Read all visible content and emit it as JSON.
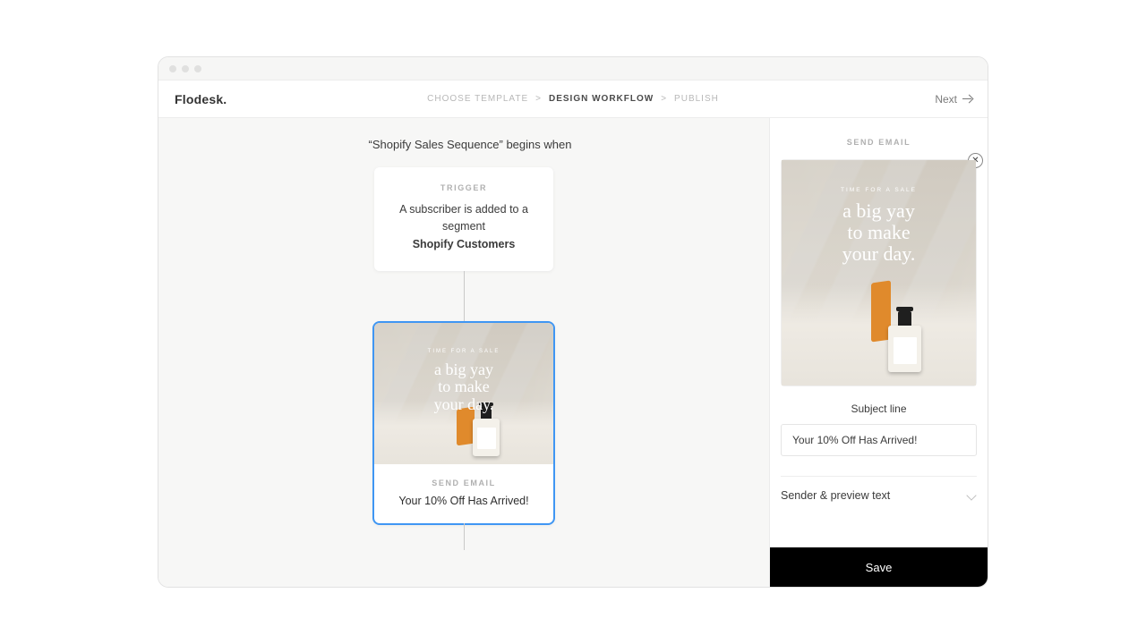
{
  "brand": "Flodesk.",
  "wizard": {
    "step1": "CHOOSE TEMPLATE",
    "step2": "DESIGN WORKFLOW",
    "step3": "PUBLISH"
  },
  "next_label": "Next",
  "canvas": {
    "title": "“Shopify Sales Sequence” begins when",
    "trigger": {
      "label": "TRIGGER",
      "line1": "A subscriber is added to a segment",
      "segment": "Shopify Customers"
    },
    "email_card": {
      "label": "SEND EMAIL",
      "subject": "Your 10% Off Has Arrived!",
      "hero_eyebrow": "TIME FOR A SALE",
      "hero_headline_1": "a big yay",
      "hero_headline_2": "to make",
      "hero_headline_3": "your day."
    }
  },
  "panel": {
    "label": "SEND EMAIL",
    "hero_eyebrow": "TIME FOR A SALE",
    "hero_headline_1": "a big yay",
    "hero_headline_2": "to make",
    "hero_headline_3": "your day.",
    "subject_label": "Subject line",
    "subject_value": "Your 10% Off Has Arrived!",
    "sender_section": "Sender & preview text",
    "save_label": "Save"
  }
}
